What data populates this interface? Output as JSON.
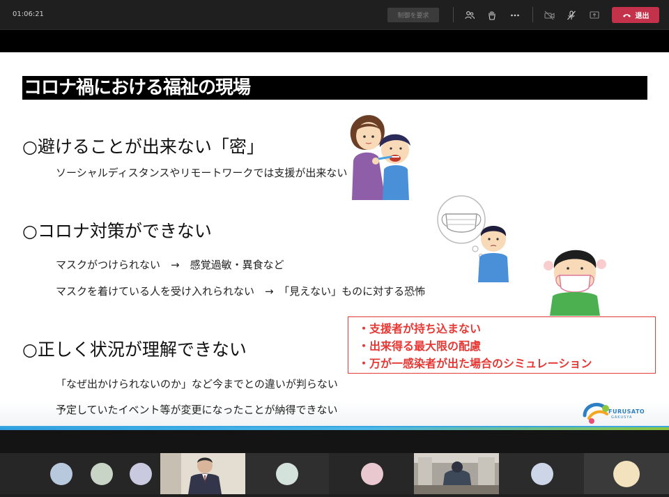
{
  "topbar": {
    "timer": "01:06:21",
    "request_control_label": "制御を要求",
    "leave_label": "退出",
    "icons": [
      "participants-icon",
      "raise-hand-icon",
      "more-options-icon",
      "camera-off-icon",
      "mic-off-icon",
      "share-screen-icon",
      "phone-hangup-icon"
    ]
  },
  "slide": {
    "title": "コロナ禍における福祉の現場",
    "sections": [
      {
        "heading": "○避けることが出来ない「密」",
        "lines": [
          "ソーシャルディスタンスやリモートワークでは支援が出来ない"
        ]
      },
      {
        "heading": "○コロナ対策ができない",
        "lines": [
          "マスクがつけられない　→　感覚過敏・異食など",
          "マスクを着けている人を受け入れられない　→　「見えない」ものに対する恐怖"
        ]
      },
      {
        "heading": "○正しく状況が理解できない",
        "lines": [
          "「なぜ出かけられないのか」など今までとの違いが判らない",
          "予定していたイベント等が変更になったことが納得できない"
        ]
      }
    ],
    "callout": [
      "・支援者が持ち込まない",
      "・出来得る最大限の配慮",
      "・万が一感染者が出た場合のシミュレーション"
    ],
    "logo": {
      "name": "FURUSATO",
      "sub": "GAKUSYA"
    }
  },
  "colors": {
    "leave": "#c4314b",
    "callout": "#e53935",
    "title_bar": "#000000"
  }
}
